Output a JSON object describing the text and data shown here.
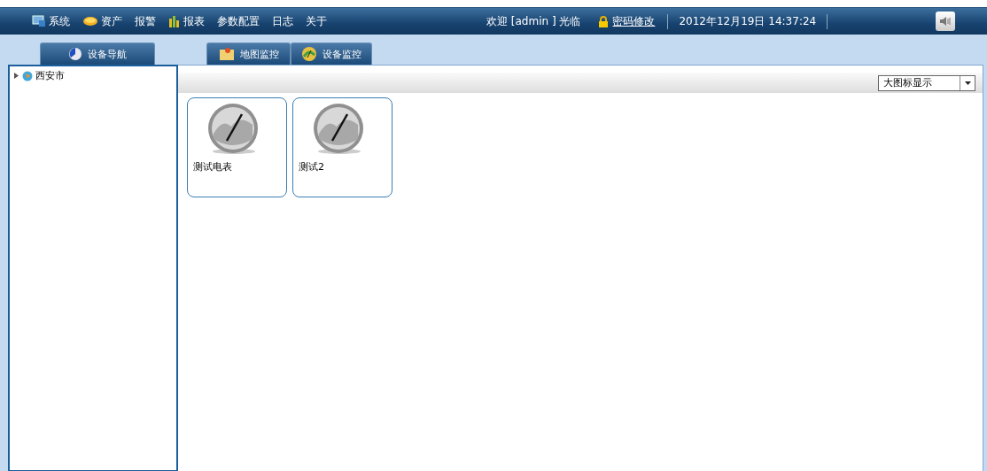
{
  "menu": [
    {
      "label": "系统",
      "kind": "icon"
    },
    {
      "label": "资产",
      "kind": "icon"
    },
    {
      "label": "报警",
      "kind": "plain"
    },
    {
      "label": "报表",
      "kind": "icon"
    },
    {
      "label": "参数配置",
      "kind": "plain"
    },
    {
      "label": "日志",
      "kind": "plain"
    },
    {
      "label": "关于",
      "kind": "plain"
    }
  ],
  "header": {
    "welcome": "欢迎 [admin ] 光临",
    "password_link": "密码修改",
    "datetime": "2012年12月19日  14:37:24"
  },
  "sidebar": {
    "tab": "设备导航",
    "tree": [
      {
        "label": "西安市",
        "expanded": false
      }
    ]
  },
  "tabs": [
    {
      "label": "地图监控"
    },
    {
      "label": "设备监控"
    }
  ],
  "view_select": {
    "value": "大图标显示"
  },
  "devices": [
    {
      "name": "测试电表"
    },
    {
      "name": "测试2"
    }
  ]
}
